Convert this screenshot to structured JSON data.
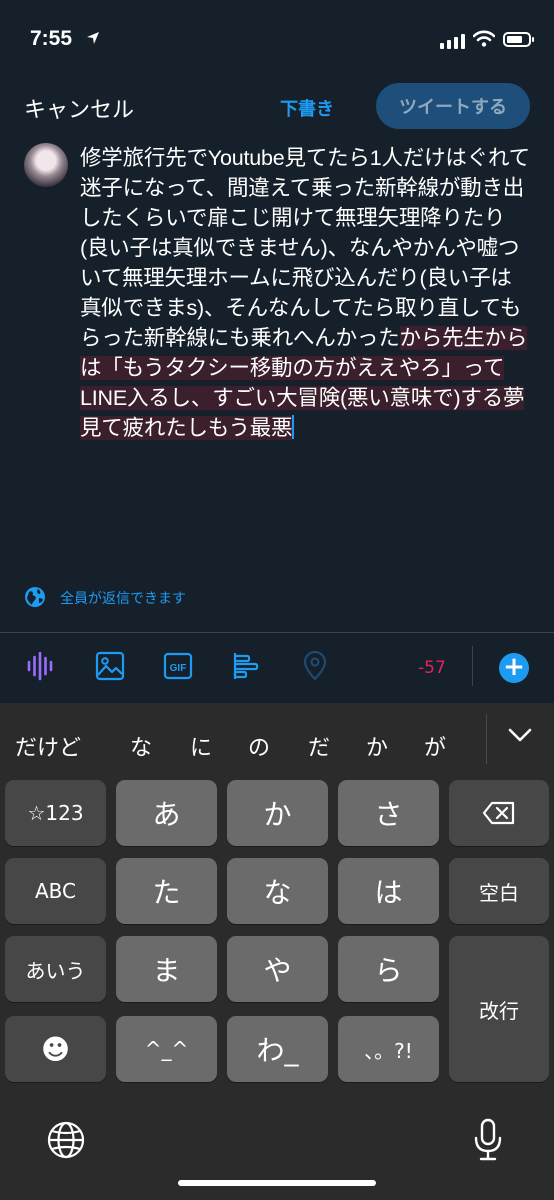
{
  "status_bar": {
    "time": "7:55"
  },
  "header": {
    "cancel": "キャンセル",
    "draft": "下書き",
    "tweet_button": "ツイートする"
  },
  "compose": {
    "text_normal": "修学旅行先でYoutube見てたら1人だけはぐれて迷子になって、間違えて乗った新幹線が動き出したくらいで扉こじ開けて無理矢理降りたり(良い子は真似できません)、なんやかんや嘘ついて無理矢理ホームに飛び込んだり(良い子は真似できまs)、そんなんしてたら取り直してもらった新幹線にも乗れへんかった",
    "text_selected": "から先生からは「もうタクシー移動の方がええやろ」ってLINE入るし、すごい大冒険(悪い意味で)する夢見て疲れたしもう最悪"
  },
  "reply_setting": {
    "label": "全員が返信できます"
  },
  "toolbar": {
    "icons": [
      "voice-wave-icon",
      "image-icon",
      "gif-icon",
      "poll-icon",
      "location-icon"
    ],
    "char_count": "-57",
    "colors": {
      "accent": "#1d9bf0",
      "warning": "#e0245e",
      "voice": "#9b6dff"
    }
  },
  "keyboard": {
    "suggestions": [
      "だけど",
      "な",
      "に",
      "の",
      "だ",
      "か",
      "が"
    ],
    "keys": {
      "sym": "☆123",
      "a": "あ",
      "ka": "か",
      "sa": "さ",
      "abc": "ABC",
      "ta": "た",
      "na": "な",
      "ha": "は",
      "space": "空白",
      "aiu": "あいう",
      "ma": "ま",
      "ya": "や",
      "ra": "ら",
      "enter": "改行",
      "emoji": "☻",
      "kaomoji": "^_^",
      "wa": "わ_",
      "punct": "、。?!"
    }
  }
}
